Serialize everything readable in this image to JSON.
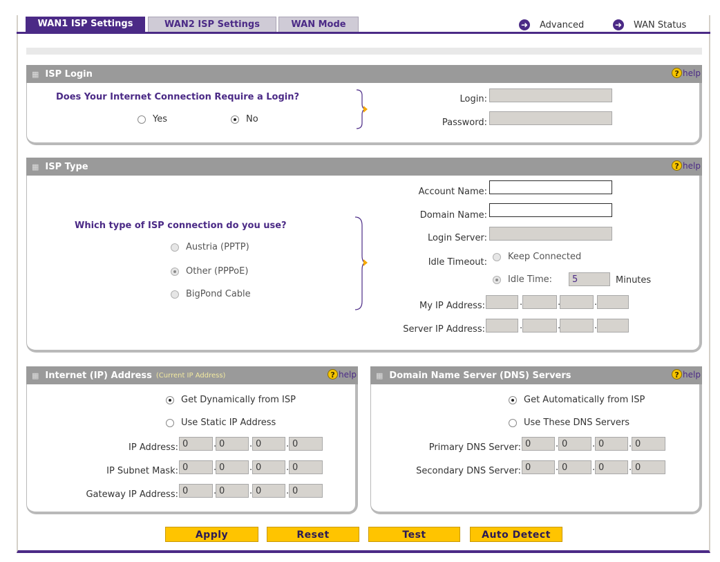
{
  "tabs": [
    {
      "label": "WAN1 ISP Settings"
    },
    {
      "label": "WAN2 ISP Settings"
    },
    {
      "label": "WAN Mode"
    }
  ],
  "top_links": {
    "advanced": "Advanced",
    "wan_status": "WAN Status"
  },
  "help_label": "help",
  "isp_login": {
    "title": "ISP Login",
    "question": "Does Your Internet Connection Require a Login?",
    "options": [
      "Yes",
      "No"
    ],
    "selected": "No",
    "login_label": "Login:",
    "password_label": "Password:",
    "login_value": "",
    "password_value": ""
  },
  "isp_type": {
    "title": "ISP Type",
    "question": "Which type of ISP connection do you use?",
    "options": [
      "Austria (PPTP)",
      "Other (PPPoE)",
      "BigPond Cable"
    ],
    "selected": "Other (PPPoE)",
    "account_name_label": "Account Name:",
    "domain_name_label": "Domain Name:",
    "login_server_label": "Login Server:",
    "idle_timeout_label": "Idle Timeout:",
    "keep_connected_label": "Keep Connected",
    "idle_time_label": "Idle Time:",
    "idle_time_value": "5",
    "minutes_label": "Minutes",
    "my_ip_label": "My IP Address:",
    "server_ip_label": "Server IP Address:"
  },
  "internet_ip": {
    "title": "Internet (IP) Address",
    "subtitle": "(Current IP Address)",
    "opt_dynamic": "Get Dynamically from ISP",
    "opt_static": "Use Static IP Address",
    "selected": "Get Dynamically from ISP",
    "ip_label": "IP Address:",
    "mask_label": "IP Subnet Mask:",
    "gateway_label": "Gateway IP Address:",
    "ip": [
      "0",
      "0",
      "0",
      "0"
    ],
    "mask": [
      "0",
      "0",
      "0",
      "0"
    ],
    "gateway": [
      "0",
      "0",
      "0",
      "0"
    ]
  },
  "dns": {
    "title": "Domain Name Server (DNS) Servers",
    "opt_auto": "Get Automatically from ISP",
    "opt_manual": "Use These DNS Servers",
    "selected": "Get Automatically from ISP",
    "primary_label": "Primary DNS Server:",
    "secondary_label": "Secondary DNS Server:",
    "primary": [
      "0",
      "0",
      "0",
      "0"
    ],
    "secondary": [
      "0",
      "0",
      "0",
      "0"
    ]
  },
  "buttons": {
    "apply": "Apply",
    "reset": "Reset",
    "test": "Test",
    "auto_detect": "Auto Detect"
  },
  "colors": {
    "accent": "#4b2a86",
    "bar": "#9a9a9a",
    "button": "#ffc400",
    "help": "#f5c400"
  }
}
